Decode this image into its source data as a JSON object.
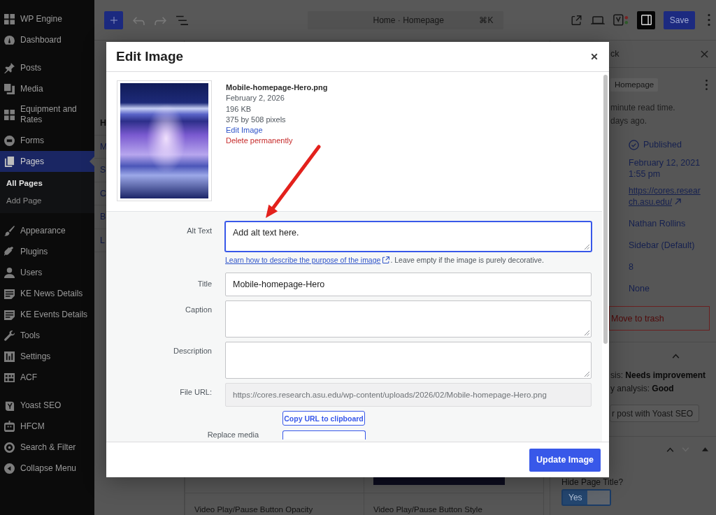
{
  "admin_menu": {
    "groups": [
      {
        "items": [
          {
            "label": "WP Engine",
            "selected": false
          },
          {
            "label": "Dashboard",
            "selected": false
          }
        ]
      },
      {
        "items": [
          {
            "label": "Posts",
            "selected": false
          },
          {
            "label": "Media",
            "selected": false
          },
          {
            "label": "Equipment and Rates",
            "selected": false
          },
          {
            "label": "Forms",
            "selected": false
          },
          {
            "label": "Pages",
            "selected": true,
            "children": [
              {
                "label": "All Pages",
                "selected": true
              },
              {
                "label": "Add Page",
                "selected": false
              }
            ]
          },
          {
            "label": "Appearance",
            "selected": false
          },
          {
            "label": "Plugins",
            "selected": false
          },
          {
            "label": "Users",
            "selected": false
          },
          {
            "label": "KE News Details",
            "selected": false
          },
          {
            "label": "KE Events Details",
            "selected": false
          },
          {
            "label": "Tools",
            "selected": false
          },
          {
            "label": "Settings",
            "selected": false
          },
          {
            "label": "ACF",
            "selected": false
          }
        ]
      },
      {
        "items": [
          {
            "label": "Yoast SEO",
            "selected": false
          },
          {
            "label": "HFCM",
            "selected": false
          },
          {
            "label": "Search & Filter",
            "selected": false
          },
          {
            "label": "Collapse Menu",
            "selected": false
          }
        ]
      }
    ]
  },
  "toolbar": {
    "undo_enabled": false,
    "redo_enabled": false,
    "document_title": "Home · Homepage",
    "shortcut": "⌘K",
    "settings_toggle_on": true,
    "save_label": "Save"
  },
  "canvas": {
    "list_view": [
      {
        "text": "H",
        "kind": "heading"
      },
      {
        "text": "M",
        "kind": "link"
      },
      {
        "text": "S",
        "kind": "link"
      },
      {
        "text": "C",
        "kind": "link"
      },
      {
        "text": "B",
        "kind": "link"
      },
      {
        "text": "L",
        "kind": "link"
      }
    ],
    "blocks": [
      {
        "label": "Video Play/Pause Button Opacity"
      },
      {
        "label": "Video Play/Pause Button Style"
      }
    ]
  },
  "settings_sidebar": {
    "tab": "ck",
    "template_chip": "Homepage",
    "read_time": "minute read time.",
    "modified": "days ago.",
    "status": "Published",
    "publish_date": "February 12, 2021",
    "publish_time": "1:55 pm",
    "link": "https://cores.research.asu.edu/",
    "values": [
      "Nathan Rollins",
      "Sidebar (Default)",
      "8",
      "None"
    ],
    "trash_button": "Move to trash",
    "seo_panel": {
      "expanded": true,
      "lines": [
        "sis: **Needs improvement**",
        "y analysis: **Good**"
      ],
      "button": "r post with Yoast SEO"
    },
    "meta_panel": {
      "move_up_enabled": true,
      "move_down_enabled": false,
      "expanded": true,
      "field_label": "Hide Page Title?",
      "toggle": {
        "label": "Yes",
        "on": true
      }
    }
  },
  "modal": {
    "title": "Edit Image",
    "file": {
      "name": "Mobile-homepage-Hero.png",
      "date": "February 2, 2026",
      "size": "196 KB",
      "dimensions": "375 by 508 pixels",
      "edit_link": "Edit Image",
      "delete_link": "Delete permanently"
    },
    "fields": [
      {
        "label": "Alt Text",
        "kind": "textarea",
        "value": "Add alt text here.",
        "focused": true,
        "help_link": "Learn how to describe the purpose of the image",
        "help_text": ". Leave empty if the image is purely decorative."
      },
      {
        "label": "Title",
        "kind": "input",
        "value": "Mobile-homepage-Hero",
        "focused": false
      },
      {
        "label": "Caption",
        "kind": "textarea",
        "focused": false
      },
      {
        "label": "Description",
        "kind": "textarea",
        "focused": false
      },
      {
        "label": "File URL:",
        "kind": "readonly",
        "value": "https://cores.research.asu.edu/wp-content/uploads/2026/02/Mobile-homepage-Hero.png",
        "focused": false
      }
    ],
    "copy_button": "Copy URL to clipboard",
    "replace_label": "Replace media",
    "submit_button": "Update Image"
  }
}
